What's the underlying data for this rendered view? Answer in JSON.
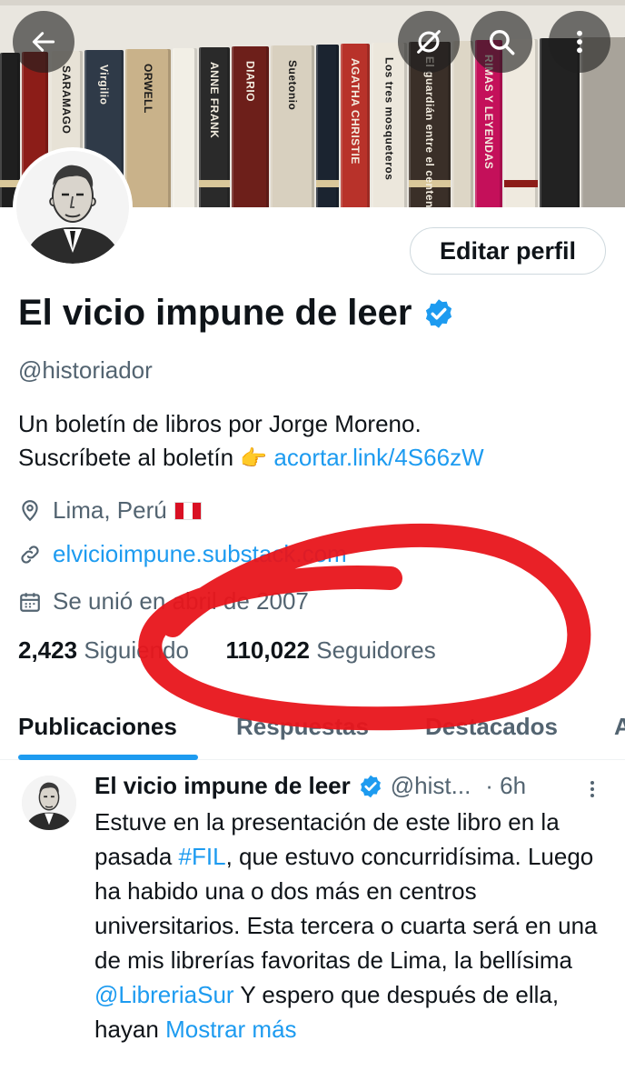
{
  "header": {
    "back_icon": "arrow-left-icon",
    "hide_icon": "eye-slash-icon",
    "search_icon": "search-icon",
    "more_icon": "more-vertical-icon"
  },
  "banner": {
    "book_titles": [
      "SARAMAGO",
      "Virgilio",
      "ORWELL",
      "ANNE FRANK",
      "DIARIO",
      "Suetonio",
      "AGATHA CHRISTIE",
      "Los tres mosqueteros",
      "El guardián entre el centeno",
      "RIMAS Y LEYENDAS"
    ]
  },
  "profile": {
    "edit_button": "Editar perfil",
    "name": "El vicio impune de leer",
    "handle": "@historiador",
    "bio_line1": "Un boletín de libros por Jorge Moreno.",
    "bio_line2_prefix": "Suscríbete al boletín",
    "bio_emoji": "👉",
    "bio_link": "acortar.link/4S66zW",
    "location": "Lima, Perú",
    "website": "elvicioimpune.substack.com",
    "joined": "Se unió en abril de 2007",
    "following_count": "2,423",
    "following_label": "Siguiendo",
    "followers_count": "110,022",
    "followers_label": "Seguidores"
  },
  "tabs": [
    "Publicaciones",
    "Respuestas",
    "Destacados",
    "A"
  ],
  "active_tab": "Publicaciones",
  "tweet": {
    "name": "El vicio impune de leer",
    "handle": "@hist...",
    "time": "· 6h",
    "text_1": "Estuve en la presentación de este libro en la pasada ",
    "hashtag": "#FIL",
    "text_2": ", que estuvo concurridísima. Luego ha habido una o dos más en centros universitarios. Esta tercera o cuarta será en una de mis librerías favoritas de Lima, la bellísima ",
    "mention": "@LibreriaSur",
    "text_3": " Y espero que después de ella, hayan ",
    "show_more": "Mostrar más"
  },
  "colors": {
    "accent": "#1d9bf0",
    "text": "#0f1419",
    "secondary": "#536471",
    "annotation": "#e8151b"
  }
}
